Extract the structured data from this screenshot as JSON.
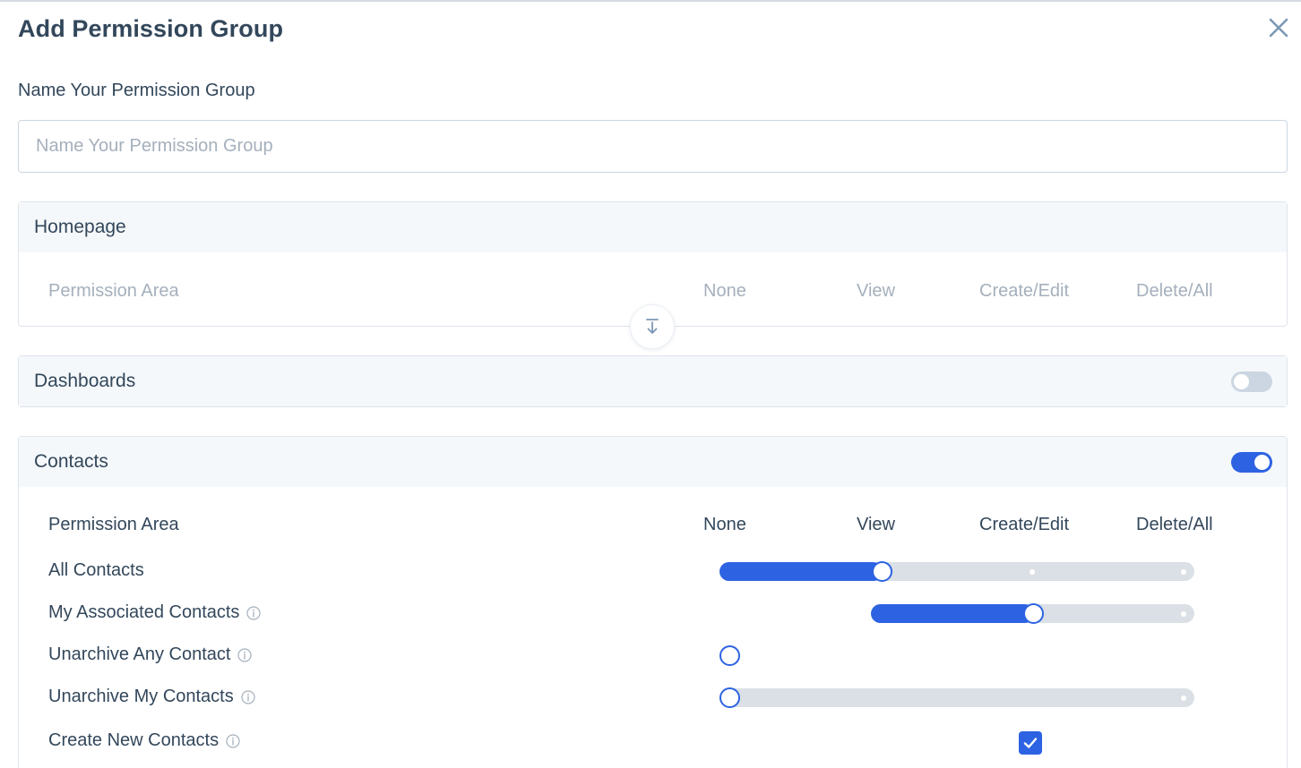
{
  "dialog": {
    "title": "Add Permission Group"
  },
  "name_field": {
    "label": "Name Your Permission Group",
    "placeholder": "Name Your Permission Group",
    "value": ""
  },
  "columns": {
    "area": "Permission Area",
    "none": "None",
    "view": "View",
    "create_edit": "Create/Edit",
    "delete_all": "Delete/All"
  },
  "sections": {
    "homepage": {
      "title": "Homepage"
    },
    "dashboards": {
      "title": "Dashboards",
      "toggle_on": false
    },
    "contacts": {
      "title": "Contacts",
      "toggle_on": true,
      "rows": [
        {
          "label": "All Contacts",
          "control": "slider",
          "levels": [
            "None",
            "View",
            "Create/Edit",
            "Delete/All"
          ],
          "selected": "View",
          "has_info": false
        },
        {
          "label": "My Associated Contacts",
          "control": "slider",
          "levels": [
            "View",
            "Create/Edit",
            "Delete/All"
          ],
          "selected": "Create/Edit",
          "has_info": true
        },
        {
          "label": "Unarchive Any Contact",
          "control": "radio",
          "levels": [
            "None"
          ],
          "selected": "None",
          "has_info": true
        },
        {
          "label": "Unarchive My Contacts",
          "control": "slider",
          "levels": [
            "None",
            "Delete/All"
          ],
          "selected": "None",
          "has_info": true
        },
        {
          "label": "Create New Contacts",
          "control": "checkbox",
          "checked": true,
          "has_info": true
        }
      ]
    }
  },
  "colors": {
    "accent": "#2d63e2",
    "track": "#dbe0e6",
    "text": "#33475b",
    "muted": "#a5b0bc",
    "header_bg": "#f5f8fa"
  },
  "icons": {
    "close": "close-icon",
    "expand": "arrow-down-to-line-icon",
    "info": "info-icon",
    "check": "checkmark-icon"
  }
}
